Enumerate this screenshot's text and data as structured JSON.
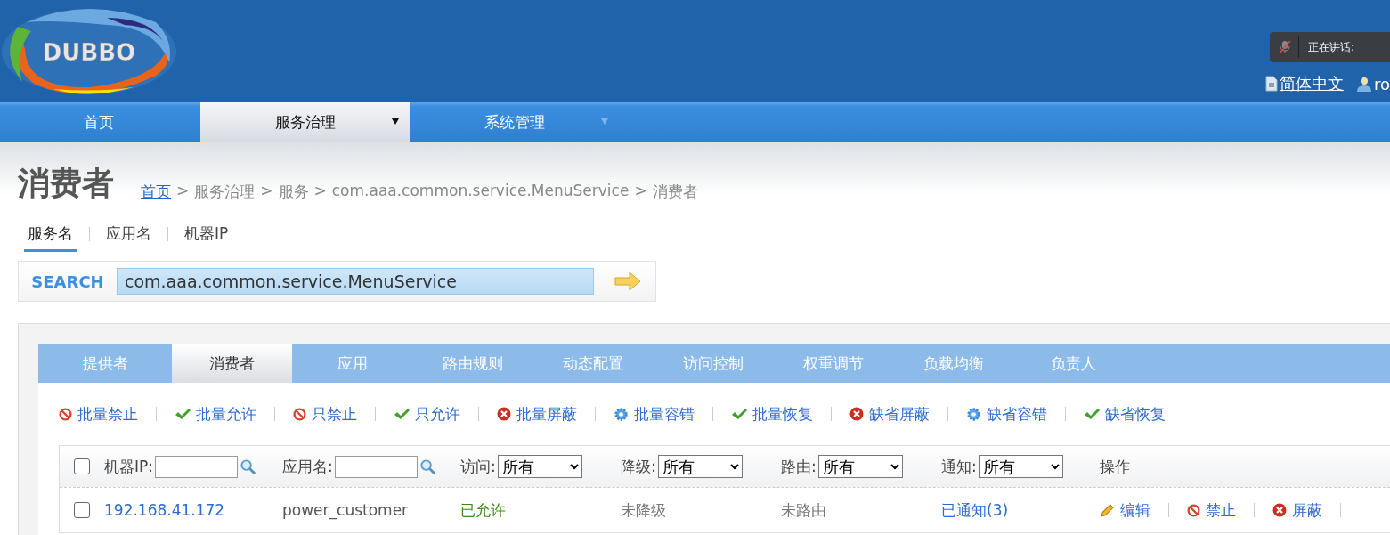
{
  "header": {
    "logo": "DUBBO",
    "voice": {
      "muted": true,
      "label": "正在讲话:"
    },
    "language": "简体中文",
    "user": "ro"
  },
  "nav": [
    {
      "label": "首页",
      "selected": false,
      "dropdown": false
    },
    {
      "label": "服务治理",
      "selected": true,
      "dropdown": true
    },
    {
      "label": "系统管理",
      "selected": false,
      "dropdown": true
    }
  ],
  "page_title": "消费者",
  "breadcrumb": [
    {
      "label": "首页",
      "link": true
    },
    {
      "separator": ">",
      "label": "服务治理",
      "link": false
    },
    {
      "separator": ">",
      "label": "服务",
      "link": false
    },
    {
      "separator": ">",
      "label": "com.aaa.common.service.MenuService",
      "link": false
    },
    {
      "separator": ">",
      "label": "消费者",
      "link": false
    }
  ],
  "search_tabs": [
    {
      "label": "服务名",
      "selected": true
    },
    {
      "label": "应用名",
      "selected": false
    },
    {
      "label": "机器IP",
      "selected": false
    }
  ],
  "search": {
    "label": "SEARCH",
    "value": "com.aaa.common.service.MenuService"
  },
  "tabs": [
    {
      "label": "提供者",
      "selected": false
    },
    {
      "label": "消费者",
      "selected": true
    },
    {
      "label": "应用",
      "selected": false
    },
    {
      "label": "路由规则",
      "selected": false
    },
    {
      "label": "动态配置",
      "selected": false
    },
    {
      "label": "访问控制",
      "selected": false
    },
    {
      "label": "权重调节",
      "selected": false
    },
    {
      "label": "负载均衡",
      "selected": false
    },
    {
      "label": "负责人",
      "selected": false
    }
  ],
  "actions": [
    {
      "label": "批量禁止",
      "kind": "ban"
    },
    {
      "label": "批量允许",
      "kind": "check"
    },
    {
      "label": "只禁止",
      "kind": "ban"
    },
    {
      "label": "只允许",
      "kind": "check"
    },
    {
      "label": "批量屏蔽",
      "kind": "cross"
    },
    {
      "label": "批量容错",
      "kind": "gear"
    },
    {
      "label": "批量恢复",
      "kind": "check"
    },
    {
      "label": "缺省屏蔽",
      "kind": "cross"
    },
    {
      "label": "缺省容错",
      "kind": "gear"
    },
    {
      "label": "缺省恢复",
      "kind": "check"
    }
  ],
  "table": {
    "select_all": {
      "checked": false
    },
    "filters": [
      {
        "label": "机器IP:",
        "kind": "search"
      },
      {
        "label": "应用名:",
        "kind": "search"
      },
      {
        "label": "访问:",
        "kind": "select",
        "value": "所有"
      },
      {
        "label": "降级:",
        "kind": "select",
        "value": "所有"
      },
      {
        "label": "路由:",
        "kind": "select",
        "value": "所有"
      },
      {
        "label": "通知:",
        "kind": "select",
        "value": "所有"
      }
    ],
    "operations_header": "操作",
    "rows": [
      {
        "checked": false,
        "cells": [
          {
            "text": "192.168.41.172",
            "kind": "link"
          },
          {
            "text": "power_customer",
            "kind": "text"
          },
          {
            "text": "已允许",
            "kind": "allowed"
          },
          {
            "text": "未降级",
            "kind": "muted"
          },
          {
            "text": "未路由",
            "kind": "muted"
          },
          {
            "text": "已通知(3)",
            "kind": "link"
          }
        ],
        "operations": [
          {
            "label": "编辑",
            "kind": "edit"
          },
          {
            "label": "禁止",
            "kind": "ban"
          },
          {
            "label": "屏蔽",
            "kind": "cross"
          }
        ]
      }
    ]
  }
}
